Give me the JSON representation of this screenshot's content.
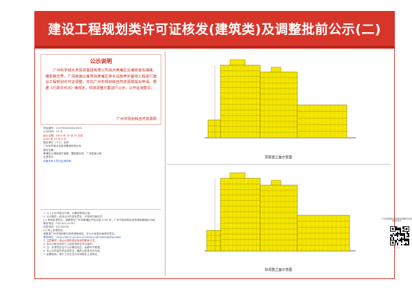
{
  "title": "建设工程规划类许可证核发(建筑类)及调整批前公示(二)",
  "notice": {
    "heading": "公示说明",
    "body": "广州科学城水务投资集团有限公司拟对黄埔区云埔街道东接路、捷胜路交界，广深高速以南地块黄埔区排水设施养护基地工程进行建设工程规划许可证调整，并向广州市规划和自然资源局提出申请。根据《行政许可法》等规定，现将调整方案进行公示，公开征询意见。",
    "signature": "广州市规划和自然资源局"
  },
  "info": {
    "lines": [
      {
        "text": "项目编号：2019000000044300",
        "style": ""
      },
      {
        "text": "公示时间：10 天",
        "style": ""
      },
      {
        "text": "起止日期：2024 年 10 月 21 日至",
        "style": "red"
      },
      {
        "text": "          2024 年 11 月 5 日",
        "style": "red"
      },
      {
        "text": "建设单位（个人）名称：",
        "style": ""
      },
      {
        "text": "  广州科学城水务投资集团有限公司",
        "style": ""
      },
      {
        "text": "建设位置：",
        "style": ""
      },
      {
        "text": "  黄埔区云埔街道东接路、捷胜路北侧，广深高速以南",
        "style": ""
      },
      {
        "text": "反馈意见：",
        "style": ""
      },
      {
        "text": "  利害关系人意见征询说明",
        "style": "blue"
      }
    ]
  },
  "tips": {
    "lines": [
      {
        "text": "1. 以上公示内容为方案，以最终审批为准。",
        "style": ""
      },
      {
        "text": "2. 公示期内，如对公示内容有意见，可采用书面形式：",
        "style": ""
      },
      {
        "text": "(1) 现场反馈意见：请携带至广州市黄埔区开创大道 2700 号，广州市规划和自然资源局黄埔区分局；",
        "style": ""
      },
      {
        "text": "   联系电话：020-82113700",
        "style": ""
      },
      {
        "text": "   传真号码：82165256",
        "style": ""
      },
      {
        "text": "(2) 网上反馈意见：",
        "style": ""
      },
      {
        "text": "   请登录广州市规划和自然资源局网站，在公示信息页面填写意见。",
        "style": ""
      },
      {
        "text": "   具体网址：https://ghzyj.gz.gov.cn/ywpd/cxgh/jsfangbgfp/pqgs/",
        "style": "blue"
      },
      {
        "text": "3. 注意事项：请公众提供真实有效的联系方式。",
        "style": "red"
      },
      {
        "text": "4. 本公示所涉及的个人信息将依法予以保护。",
        "style": ""
      },
      {
        "text": "5. 注：反馈意见应于公示期内送达，逾期不予受理。",
        "style": ""
      },
      {
        "text": "6. 本公示内容仅供征询意见，最终以批准文件为准。",
        "style": ""
      },
      {
        "text": "7. 如需咨询，请于工作日办公时间联系上述单位。",
        "style": ""
      }
    ]
  },
  "drawings": [
    {
      "caption": "原报建立面示意图"
    },
    {
      "caption": "拟调整立面示意图"
    }
  ],
  "qr": {
    "label_top": "广州市规划和自然资源局黄埔区分局政务服务平台",
    "label_bottom": "扫一扫"
  },
  "colors": {
    "brand_red": "#d7352a",
    "building_fill": "#f5e600",
    "building_line": "#8a7d00"
  }
}
